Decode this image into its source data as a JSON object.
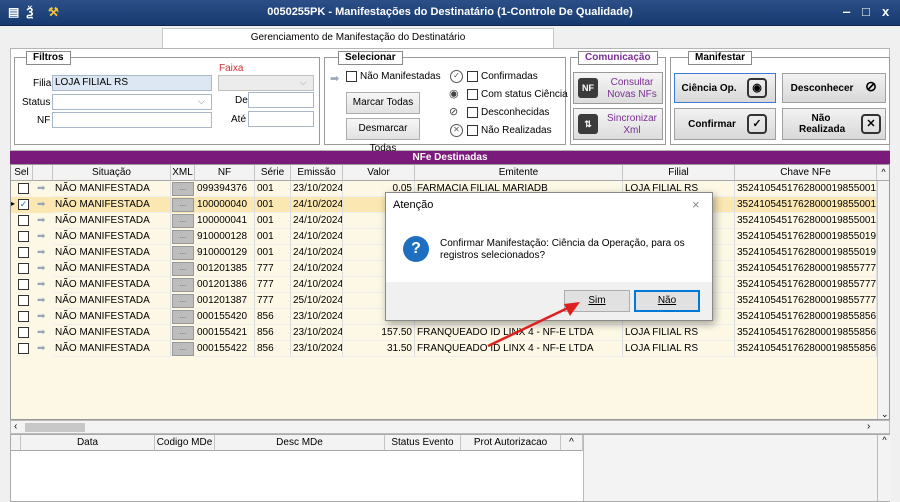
{
  "window": {
    "title": "0050255PK - Manifestações do Destinatário (1-Controle De Qualidade)",
    "minimize": "‒",
    "maximize": "□",
    "close": "x"
  },
  "tab": {
    "label": "Gerenciamento de Manifestação do Destinatário"
  },
  "filtros": {
    "title": "Filtros",
    "faixa_label": "Faixa",
    "filial_label": "Filial",
    "filial_value": "LOJA FILIAL RS",
    "status_label": "Status",
    "status_value": "",
    "nf_label": "NF",
    "nf_value": "",
    "de_label": "De",
    "ate_label": "Até"
  },
  "selecionar": {
    "title": "Selecionar",
    "nao_manifestadas": "Não Manifestadas",
    "marcar_todas": "Marcar Todas",
    "desmarcar_todas": "Desmarcar Todas",
    "confirmadas": "Confirmadas",
    "com_status_ciencia": "Com status Ciência",
    "desconhecidas": "Desconhecidas",
    "nao_realizadas": "Não Realizadas"
  },
  "comunicacao": {
    "title": "Comunicação",
    "consultar": "Consultar Novas NFs",
    "sincronizar": "Sincronizar Xml"
  },
  "manifestar": {
    "title": "Manifestar",
    "ciencia": "Ciência Op.",
    "desconhecer": "Desconhecer",
    "confirmar": "Confirmar",
    "nao_realizada": "Não Realizada"
  },
  "grid": {
    "title": "NFe Destinadas",
    "columns": [
      "Sel",
      "Situação",
      "XML",
      "NF",
      "Série",
      "Emissão",
      "Valor",
      "Emitente",
      "Filial",
      "Chave NFe"
    ],
    "xml_button": "...",
    "rows": [
      {
        "situacao": "NÃO MANIFESTADA",
        "nf": "099394376",
        "serie": "001",
        "emissao": "23/10/2024",
        "valor": "0.05",
        "emitente": "FARMACIA FILIAL MARIADB",
        "filial": "LOJA FILIAL RS",
        "chave": "35241054517628000198550010",
        "checked": false,
        "selected": false
      },
      {
        "situacao": "NÃO MANIFESTADA",
        "nf": "100000040",
        "serie": "001",
        "emissao": "24/10/2024",
        "valor": "",
        "emitente": "",
        "filial": "",
        "chave": "35241054517628000198550011",
        "checked": true,
        "selected": true
      },
      {
        "situacao": "NÃO MANIFESTADA",
        "nf": "100000041",
        "serie": "001",
        "emissao": "24/10/2024",
        "valor": "",
        "emitente": "",
        "filial": "",
        "chave": "35241054517628000198550011",
        "checked": false,
        "selected": false
      },
      {
        "situacao": "NÃO MANIFESTADA",
        "nf": "910000128",
        "serie": "001",
        "emissao": "24/10/2024",
        "valor": "",
        "emitente": "",
        "filial": "",
        "chave": "35241054517628000198550191",
        "checked": false,
        "selected": false
      },
      {
        "situacao": "NÃO MANIFESTADA",
        "nf": "910000129",
        "serie": "001",
        "emissao": "24/10/2024",
        "valor": "",
        "emitente": "",
        "filial": "",
        "chave": "35241054517628000198550191",
        "checked": false,
        "selected": false
      },
      {
        "situacao": "NÃO MANIFESTADA",
        "nf": "001201385",
        "serie": "777",
        "emissao": "24/10/2024",
        "valor": "",
        "emitente": "",
        "filial": "",
        "chave": "35241054517628000198557770",
        "checked": false,
        "selected": false
      },
      {
        "situacao": "NÃO MANIFESTADA",
        "nf": "001201386",
        "serie": "777",
        "emissao": "24/10/2024",
        "valor": "",
        "emitente": "",
        "filial": "",
        "chave": "35241054517628000198557770",
        "checked": false,
        "selected": false
      },
      {
        "situacao": "NÃO MANIFESTADA",
        "nf": "001201387",
        "serie": "777",
        "emissao": "25/10/2024",
        "valor": "",
        "emitente": "",
        "filial": "",
        "chave": "35241054517628000198557770",
        "checked": false,
        "selected": false
      },
      {
        "situacao": "NÃO MANIFESTADA",
        "nf": "000155420",
        "serie": "856",
        "emissao": "23/10/2024",
        "valor": "",
        "emitente": "",
        "filial": "",
        "chave": "35241054517628000198558560",
        "checked": false,
        "selected": false
      },
      {
        "situacao": "NÃO MANIFESTADA",
        "nf": "000155421",
        "serie": "856",
        "emissao": "23/10/2024",
        "valor": "157.50",
        "emitente": "FRANQUEADO ID LINX 4 - NF-E LTDA",
        "filial": "LOJA FILIAL RS",
        "chave": "35241054517628000198558560",
        "checked": false,
        "selected": false
      },
      {
        "situacao": "NÃO MANIFESTADA",
        "nf": "000155422",
        "serie": "856",
        "emissao": "23/10/2024",
        "valor": "31.50",
        "emitente": "FRANQUEADO ID LINX 4 - NF-E LTDA",
        "filial": "LOJA FILIAL RS",
        "chave": "35241054517628000198558560",
        "checked": false,
        "selected": false
      }
    ]
  },
  "bottom_grid": {
    "columns": [
      "Data",
      "Codigo MDe",
      "Desc MDe",
      "Status Evento",
      "Prot Autorizacao"
    ]
  },
  "dialog": {
    "title": "Atenção",
    "close": "×",
    "message": "Confirmar Manifestação: Ciência da Operação, para os registros selecionados?",
    "yes": "Sim",
    "no": "Não"
  },
  "colors": {
    "titlebar": "#1e447b",
    "grid_header": "#7a1a7a",
    "grid_bg": "#fdf8e6",
    "accent_purple": "#7b2f95",
    "annotation_arrow": "#e02020"
  }
}
